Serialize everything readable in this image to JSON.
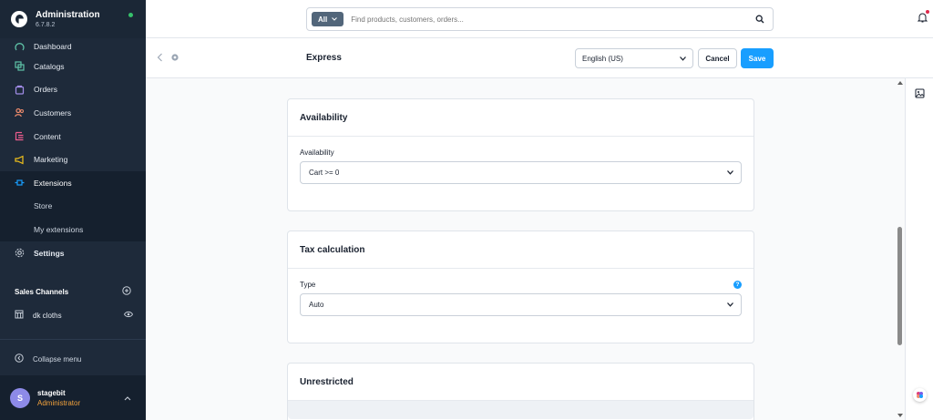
{
  "app": {
    "title": "Administration",
    "version": "6.7.8.2"
  },
  "sidebar": {
    "items": [
      {
        "label": "Dashboard",
        "icon": "dashboard-icon"
      },
      {
        "label": "Catalogs",
        "icon": "catalog-icon"
      },
      {
        "label": "Orders",
        "icon": "orders-icon"
      },
      {
        "label": "Customers",
        "icon": "customers-icon"
      },
      {
        "label": "Content",
        "icon": "content-icon"
      },
      {
        "label": "Marketing",
        "icon": "marketing-icon"
      },
      {
        "label": "Extensions",
        "icon": "extensions-icon"
      },
      {
        "label": "Store"
      },
      {
        "label": "My extensions"
      },
      {
        "label": "Settings",
        "icon": "gear-icon"
      }
    ],
    "sales_channels_title": "Sales Channels",
    "channels": [
      {
        "label": "dk cloths"
      }
    ],
    "collapse_label": "Collapse menu",
    "user": {
      "initial": "S",
      "name": "stagebit",
      "role": "Administrator"
    }
  },
  "topbar": {
    "search_scope": "All",
    "search_placeholder": "Find products, customers, orders..."
  },
  "smartbar": {
    "title": "Express",
    "language": "English (US)",
    "cancel_label": "Cancel",
    "save_label": "Save"
  },
  "cards": {
    "availability": {
      "title": "Availability",
      "field_label": "Availability",
      "value": "Cart >= 0"
    },
    "tax": {
      "title": "Tax calculation",
      "field_label": "Type",
      "value": "Auto"
    },
    "unrestricted": {
      "title": "Unrestricted"
    }
  },
  "colors": {
    "sidebar_bg": "#1e2a3a",
    "accent_blue": "#189eff",
    "role_orange": "#f0a13c",
    "status_green": "#36c16b"
  }
}
